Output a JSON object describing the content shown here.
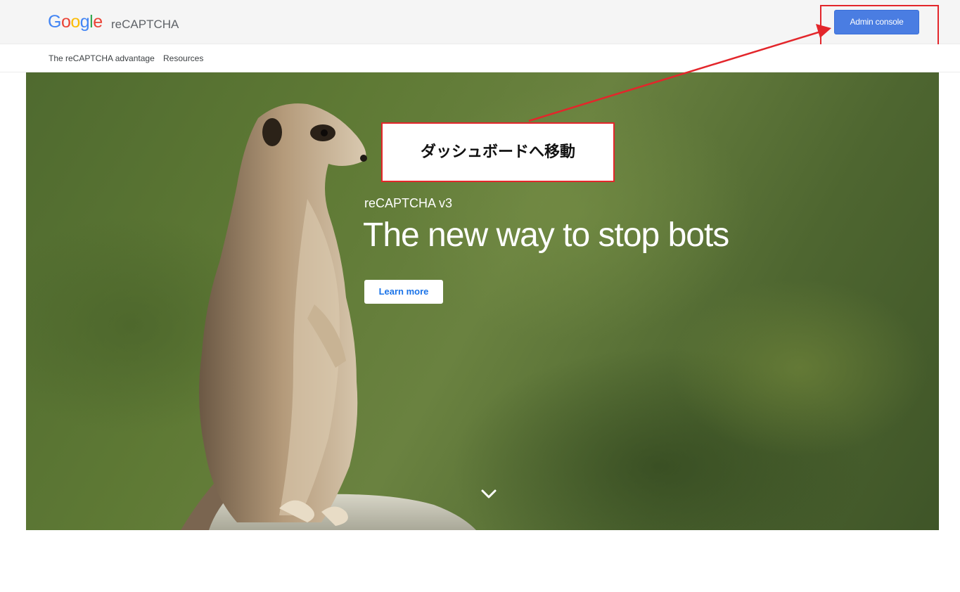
{
  "header": {
    "logo_letters": [
      "G",
      "o",
      "o",
      "g",
      "l",
      "e"
    ],
    "logo_colors": [
      "#4285F4",
      "#EA4335",
      "#FBBC05",
      "#4285F4",
      "#34A853",
      "#EA4335"
    ],
    "product_name": "reCAPTCHA",
    "admin_button_label": "Admin console"
  },
  "nav": {
    "items": [
      {
        "label": "The reCAPTCHA advantage"
      },
      {
        "label": "Resources"
      }
    ]
  },
  "hero": {
    "subtitle": "reCAPTCHA v3",
    "title": "The new way to stop bots",
    "learn_more_label": "Learn more",
    "scroll_icon": "chevron-down-icon"
  },
  "annotation": {
    "callout_text": "ダッシュボードへ移動",
    "color": "#e3262b"
  },
  "colors": {
    "accent": "#4a7de2",
    "link": "#1a73e8"
  }
}
